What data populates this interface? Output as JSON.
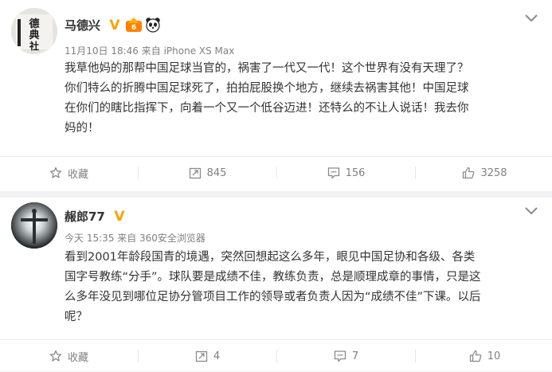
{
  "posts": [
    {
      "author": "马德兴",
      "meta": "11月10日 18:46 来自 iPhone XS Max",
      "avatar_text": "德\n典\n社",
      "text_lines": [
        "我草他妈的那帮中国足球当官的，祸害了一代又一代！这个世界有没有天理了？",
        "你们特么的折腾中国足球死了，拍拍屁股换个地方，继续去祸害其他！中国足球",
        "在你们的瞎比指挥下，向着一个又一个低谷迈进！还特么的不让人说话！我去你",
        "妈的！"
      ],
      "actions": {
        "favorite": "收藏",
        "repost": "845",
        "comment": "156",
        "like": "3258"
      }
    },
    {
      "author": "赧郎77",
      "meta": "今天 15:35 来自 360安全浏览器",
      "text_lines": [
        "看到2001年龄段国青的境遇，突然回想起这么多年，眼见中国足协和各级、各类",
        "国字号教练“分手”。球队要是成绩不佳，教练负责，总是顺理成章的事情，只是这",
        "么多年没见到哪位足协分管项目工作的领导或者负责人因为“成绩不佳”下课。以后",
        "呢？"
      ],
      "actions": {
        "favorite": "收藏",
        "repost": "4",
        "comment": "7",
        "like": "10"
      }
    }
  ],
  "colors": {
    "verified": "#f7a500",
    "text": "#333333",
    "meta": "#808080",
    "background": "#f2f2f5"
  },
  "icons": [
    "verified-badge-icon",
    "vip-icon",
    "panda-icon",
    "chevron-down-icon",
    "star-icon",
    "repost-icon",
    "comment-icon",
    "like-icon"
  ]
}
